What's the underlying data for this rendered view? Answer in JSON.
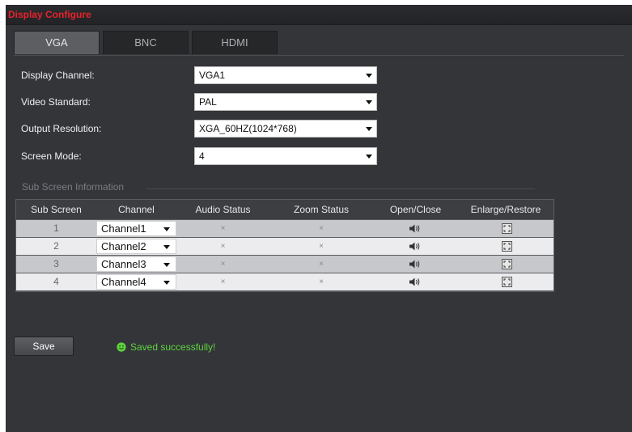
{
  "window": {
    "title": "Display Configure"
  },
  "tabs": [
    {
      "label": "VGA",
      "active": true
    },
    {
      "label": "BNC",
      "active": false
    },
    {
      "label": "HDMI",
      "active": false
    }
  ],
  "form": {
    "display_channel": {
      "label": "Display Channel:",
      "value": "VGA1"
    },
    "video_standard": {
      "label": "Video Standard:",
      "value": "PAL"
    },
    "output_resolution": {
      "label": "Output Resolution:",
      "value": "XGA_60HZ(1024*768)"
    },
    "screen_mode": {
      "label": "Screen Mode:",
      "value": "4"
    }
  },
  "sub_screen": {
    "section_title": "Sub Screen Information",
    "columns": [
      "Sub Screen",
      "Channel",
      "Audio Status",
      "Zoom Status",
      "Open/Close",
      "Enlarge/Restore"
    ],
    "rows": [
      {
        "sub_screen": "1",
        "channel": "Channel1",
        "audio_status": "×",
        "zoom_status": "×",
        "open_close_icon": "speaker-icon",
        "enlarge_icon": "enlarge-icon"
      },
      {
        "sub_screen": "2",
        "channel": "Channel2",
        "audio_status": "×",
        "zoom_status": "×",
        "open_close_icon": "speaker-icon",
        "enlarge_icon": "enlarge-icon"
      },
      {
        "sub_screen": "3",
        "channel": "Channel3",
        "audio_status": "×",
        "zoom_status": "×",
        "open_close_icon": "speaker-icon",
        "enlarge_icon": "enlarge-icon"
      },
      {
        "sub_screen": "4",
        "channel": "Channel4",
        "audio_status": "×",
        "zoom_status": "×",
        "open_close_icon": "speaker-icon",
        "enlarge_icon": "enlarge-icon"
      }
    ]
  },
  "actions": {
    "save_label": "Save"
  },
  "status": {
    "icon": "smile-icon",
    "message": "Saved successfully!"
  },
  "colors": {
    "title": "#e8222a",
    "panel_bg": "#333539",
    "status_green": "#5fd43d"
  }
}
